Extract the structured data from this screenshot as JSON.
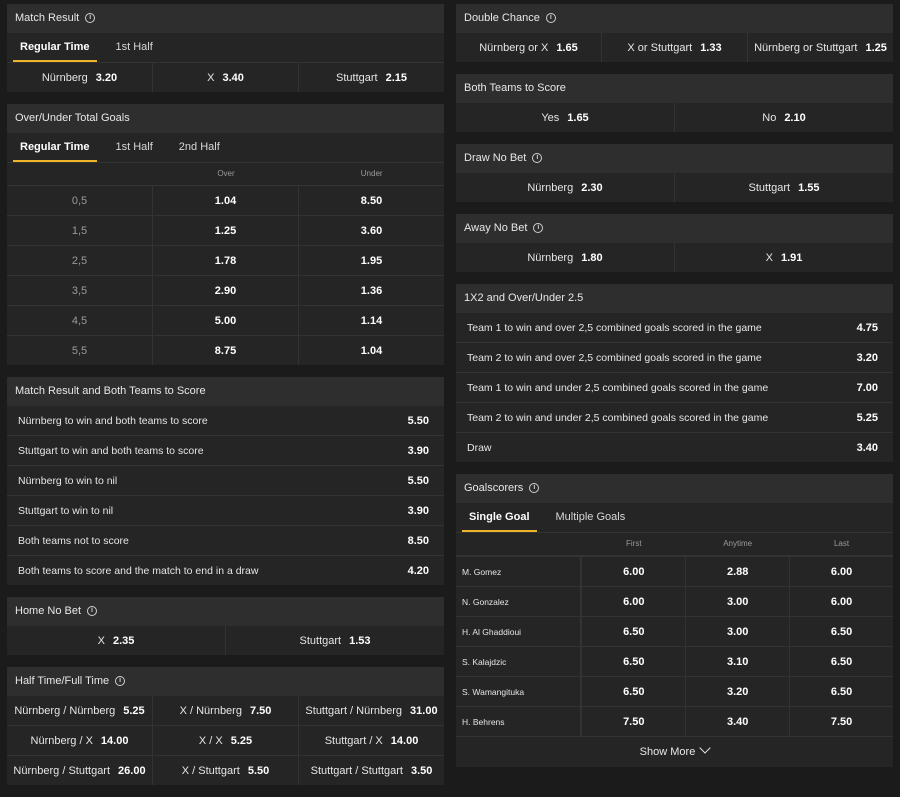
{
  "match_result": {
    "title": "Match Result",
    "tabs": [
      "Regular Time",
      "1st Half"
    ],
    "selections": [
      {
        "name": "Nürnberg",
        "odd": "3.20"
      },
      {
        "name": "X",
        "odd": "3.40"
      },
      {
        "name": "Stuttgart",
        "odd": "2.15"
      }
    ]
  },
  "over_under": {
    "title": "Over/Under Total Goals",
    "tabs": [
      "Regular Time",
      "1st Half",
      "2nd Half"
    ],
    "col_over": "Over",
    "col_under": "Under",
    "rows": [
      {
        "line": "0,5",
        "over": "1.04",
        "under": "8.50"
      },
      {
        "line": "1,5",
        "over": "1.25",
        "under": "3.60"
      },
      {
        "line": "2,5",
        "over": "1.78",
        "under": "1.95"
      },
      {
        "line": "3,5",
        "over": "2.90",
        "under": "1.36"
      },
      {
        "line": "4,5",
        "over": "5.00",
        "under": "1.14"
      },
      {
        "line": "5,5",
        "over": "8.75",
        "under": "1.04"
      }
    ]
  },
  "result_btts": {
    "title": "Match Result and Both Teams to Score",
    "rows": [
      {
        "text": "Nürnberg to win and both teams to score",
        "odd": "5.50"
      },
      {
        "text": "Stuttgart to win and both teams to score",
        "odd": "3.90"
      },
      {
        "text": "Nürnberg to win to nil",
        "odd": "5.50"
      },
      {
        "text": "Stuttgart to win to nil",
        "odd": "3.90"
      },
      {
        "text": "Both teams not to score",
        "odd": "8.50"
      },
      {
        "text": "Both teams to score and the match to end in a draw",
        "odd": "4.20"
      }
    ]
  },
  "home_no_bet": {
    "title": "Home No Bet",
    "selections": [
      {
        "name": "X",
        "odd": "2.35"
      },
      {
        "name": "Stuttgart",
        "odd": "1.53"
      }
    ]
  },
  "ht_ft": {
    "title": "Half Time/Full Time",
    "rows": [
      [
        {
          "name": "Nürnberg / Nürnberg",
          "odd": "5.25"
        },
        {
          "name": "X / Nürnberg",
          "odd": "7.50"
        },
        {
          "name": "Stuttgart / Nürnberg",
          "odd": "31.00"
        }
      ],
      [
        {
          "name": "Nürnberg / X",
          "odd": "14.00"
        },
        {
          "name": "X / X",
          "odd": "5.25"
        },
        {
          "name": "Stuttgart / X",
          "odd": "14.00"
        }
      ],
      [
        {
          "name": "Nürnberg / Stuttgart",
          "odd": "26.00"
        },
        {
          "name": "X / Stuttgart",
          "odd": "5.50"
        },
        {
          "name": "Stuttgart / Stuttgart",
          "odd": "3.50"
        }
      ]
    ]
  },
  "double_chance": {
    "title": "Double Chance",
    "selections": [
      {
        "name": "Nürnberg or X",
        "odd": "1.65"
      },
      {
        "name": "X or Stuttgart",
        "odd": "1.33"
      },
      {
        "name": "Nürnberg or Stuttgart",
        "odd": "1.25"
      }
    ]
  },
  "btts": {
    "title": "Both Teams to Score",
    "selections": [
      {
        "name": "Yes",
        "odd": "1.65"
      },
      {
        "name": "No",
        "odd": "2.10"
      }
    ]
  },
  "draw_no_bet": {
    "title": "Draw No Bet",
    "selections": [
      {
        "name": "Nürnberg",
        "odd": "2.30"
      },
      {
        "name": "Stuttgart",
        "odd": "1.55"
      }
    ]
  },
  "away_no_bet": {
    "title": "Away No Bet",
    "selections": [
      {
        "name": "Nürnberg",
        "odd": "1.80"
      },
      {
        "name": "X",
        "odd": "1.91"
      }
    ]
  },
  "x12_ou": {
    "title": "1X2 and Over/Under 2.5",
    "rows": [
      {
        "text": "Team 1 to win and over 2,5 combined goals scored in the game",
        "odd": "4.75"
      },
      {
        "text": "Team 2 to win and over 2,5 combined goals scored in the game",
        "odd": "3.20"
      },
      {
        "text": "Team 1 to win and under 2,5 combined goals scored in the game",
        "odd": "7.00"
      },
      {
        "text": "Team 2 to win and under 2,5 combined goals scored in the game",
        "odd": "5.25"
      },
      {
        "text": "Draw",
        "odd": "3.40"
      }
    ]
  },
  "goalscorers": {
    "title": "Goalscorers",
    "tabs": [
      "Single Goal",
      "Multiple Goals"
    ],
    "col_first": "First",
    "col_anytime": "Anytime",
    "col_last": "Last",
    "players": [
      {
        "name": "M. Gomez",
        "first": "6.00",
        "anytime": "2.88",
        "last": "6.00"
      },
      {
        "name": "N. Gonzalez",
        "first": "6.00",
        "anytime": "3.00",
        "last": "6.00"
      },
      {
        "name": "H. Al Ghaddioui",
        "first": "6.50",
        "anytime": "3.00",
        "last": "6.50"
      },
      {
        "name": "S. Kalajdzic",
        "first": "6.50",
        "anytime": "3.10",
        "last": "6.50"
      },
      {
        "name": "S. Wamangituka",
        "first": "6.50",
        "anytime": "3.20",
        "last": "6.50"
      },
      {
        "name": "H. Behrens",
        "first": "7.50",
        "anytime": "3.40",
        "last": "7.50"
      }
    ],
    "show_more": "Show More"
  },
  "colors": {
    "accent": "#f0b429",
    "panel": "#252525",
    "header": "#2e2e2e"
  }
}
